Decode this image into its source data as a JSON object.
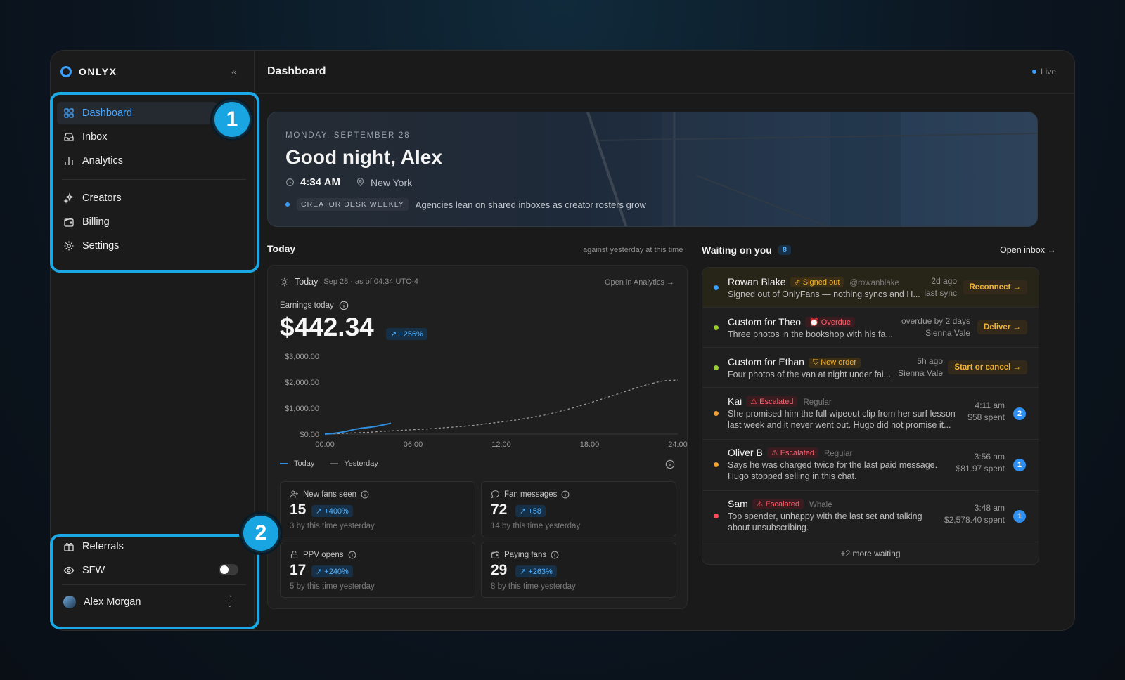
{
  "brand": {
    "name": "ONLYX"
  },
  "sidebar": {
    "items": [
      {
        "label": "Dashboard",
        "icon": "grid-icon"
      },
      {
        "label": "Inbox",
        "icon": "inbox-icon"
      },
      {
        "label": "Analytics",
        "icon": "bar-chart-icon"
      },
      {
        "label": "Creators",
        "icon": "sparkles-icon"
      },
      {
        "label": "Billing",
        "icon": "wallet-icon"
      },
      {
        "label": "Settings",
        "icon": "gear-icon"
      }
    ],
    "bottom": {
      "referrals": "Referrals",
      "sfw": "SFW",
      "sfw_on": false,
      "user": "Alex Morgan"
    },
    "callouts": [
      "1",
      "2"
    ]
  },
  "header": {
    "title": "Dashboard",
    "status": "Live"
  },
  "hero": {
    "date": "MONDAY, SEPTEMBER 28",
    "greeting": "Good night, Alex",
    "time": "4:34 AM",
    "location": "New York",
    "news_tag": "CREATOR DESK WEEKLY",
    "news_text": "Agencies lean on shared inboxes as creator rosters grow"
  },
  "today": {
    "title": "Today",
    "note": "against yesterday at this time",
    "card_title": "Today",
    "card_sub": "Sep 28 · as of 04:34 UTC-4",
    "open_link": "Open in Analytics →",
    "earnings_label": "Earnings today",
    "earnings_value": "$442.34",
    "earnings_change": "↗ +256%",
    "legend_today": "Today",
    "legend_yesterday": "Yesterday",
    "stats": [
      {
        "label": "New fans seen",
        "value": "15",
        "change": "↗ +400%",
        "sub": "3 by this time yesterday"
      },
      {
        "label": "Fan messages",
        "value": "72",
        "change": "↗ +58",
        "sub": "14 by this time yesterday"
      },
      {
        "label": "PPV opens",
        "value": "17",
        "change": "↗ +240%",
        "sub": "5 by this time yesterday"
      },
      {
        "label": "Paying fans",
        "value": "29",
        "change": "↗ +263%",
        "sub": "8 by this time yesterday"
      }
    ]
  },
  "chart_data": {
    "type": "line",
    "x_ticks": [
      "00:00",
      "06:00",
      "12:00",
      "18:00",
      "24:00"
    ],
    "y_ticks": [
      "$3,000.00",
      "$2,000.00",
      "$1,000.00",
      "$0.00"
    ],
    "ylim": [
      0,
      3000
    ],
    "xlim": [
      0,
      24
    ],
    "series": [
      {
        "name": "Today",
        "color": "#2f8fe0",
        "style": "solid",
        "x": [
          0,
          0.5,
          1,
          1.5,
          2,
          2.5,
          3,
          3.5,
          4,
          4.5
        ],
        "y": [
          0,
          20,
          60,
          110,
          180,
          230,
          260,
          300,
          360,
          420
        ]
      },
      {
        "name": "Yesterday",
        "color": "#9a9a9a",
        "style": "dashed",
        "x": [
          0,
          1,
          2,
          3,
          4,
          5,
          6,
          7,
          8,
          9,
          10,
          11,
          12,
          13,
          14,
          15,
          16,
          17,
          18,
          19,
          20,
          21,
          22,
          23,
          24
        ],
        "y": [
          0,
          20,
          50,
          70,
          110,
          140,
          170,
          200,
          240,
          280,
          330,
          400,
          470,
          540,
          640,
          740,
          880,
          1030,
          1200,
          1380,
          1560,
          1750,
          1920,
          2050,
          2080
        ]
      }
    ]
  },
  "waiting": {
    "title": "Waiting on you",
    "count": "8",
    "open_inbox": "Open inbox →",
    "more": "+2 more waiting",
    "rows": [
      {
        "name": "Rowan Blake",
        "pill": "⇗ Signed out",
        "pill_color": "yellow",
        "handle": "@rowanblake",
        "msg": "Signed out of OnlyFans — nothing syncs and H...",
        "time1": "2d ago",
        "time2": "last sync",
        "action": "Reconnect →",
        "dot": "#3aa0ff"
      },
      {
        "name": "Custom for Theo",
        "pill": "⏰ Overdue",
        "pill_color": "red",
        "handle": "",
        "msg": "Three photos in the bookshop with his fa...",
        "time1": "overdue by 2 days",
        "time2": "Sienna Vale",
        "action": "Deliver →",
        "dot": "#9acd32"
      },
      {
        "name": "Custom for Ethan",
        "pill": "⛉ New order",
        "pill_color": "yellow",
        "handle": "",
        "msg": "Four photos of the van at night under fai...",
        "time1": "5h ago",
        "time2": "Sienna Vale",
        "action": "Start or cancel →",
        "dot": "#9acd32"
      },
      {
        "name": "Kai",
        "pill": "⚠ Escalated",
        "pill_color": "red",
        "handle": "Regular",
        "msg": "She promised him the full wipeout clip from her surf lesson last week and it never went out. Hugo did not promise it...",
        "time1": "4:11 am",
        "time2": "$58 spent",
        "count": "2",
        "dot": "#f0a030"
      },
      {
        "name": "Oliver B",
        "pill": "⚠ Escalated",
        "pill_color": "red",
        "handle": "Regular",
        "msg": "Says he was charged twice for the last paid message. Hugo stopped selling in this chat.",
        "time1": "3:56 am",
        "time2": "$81.97 spent",
        "count": "1",
        "dot": "#f0a030"
      },
      {
        "name": "Sam",
        "pill": "⚠ Escalated",
        "pill_color": "red",
        "handle": "Whale",
        "msg": "Top spender, unhappy with the last set and talking about unsubscribing.",
        "time1": "3:48 am",
        "time2": "$2,578.40 spent",
        "count": "1",
        "dot": "#ff4a5a"
      }
    ]
  }
}
